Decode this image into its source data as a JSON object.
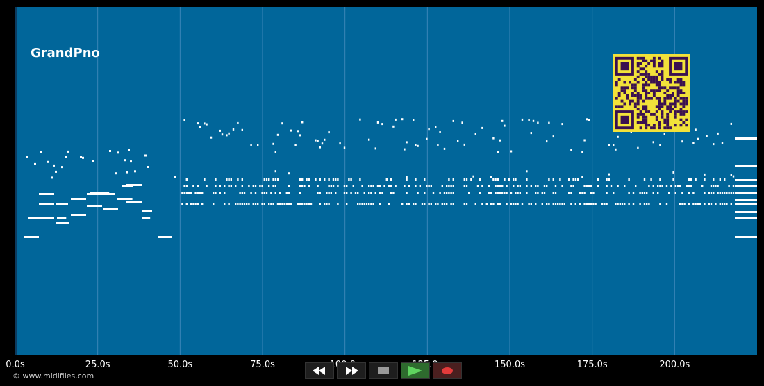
{
  "app": {
    "track_name": "GrandPno",
    "copyright": "© www.midifiles.com"
  },
  "colors": {
    "background": "#000000",
    "plot_bg": "#01669a",
    "note": "#ffffff",
    "grid": "#3b86b8",
    "qr_fg": "#3a1050",
    "qr_bg": "#f2e23a"
  },
  "timeline": {
    "unit": "s",
    "ticks": [
      "0.0s",
      "25.0s",
      "50.0s",
      "75.0s",
      "100.0s",
      "125.0s",
      "150.0s",
      "175.0s",
      "200.0s"
    ],
    "tick_values": [
      0,
      25,
      50,
      75,
      100,
      125,
      150,
      175,
      200
    ],
    "range": [
      0,
      225
    ]
  },
  "transport": {
    "buttons": [
      {
        "name": "rewind-button",
        "icon": "rewind-icon"
      },
      {
        "name": "fast-forward-button",
        "icon": "fast-forward-icon"
      },
      {
        "name": "stop-button",
        "icon": "stop-icon"
      },
      {
        "name": "play-button",
        "icon": "play-icon"
      },
      {
        "name": "record-button",
        "icon": "record-icon"
      }
    ]
  }
}
